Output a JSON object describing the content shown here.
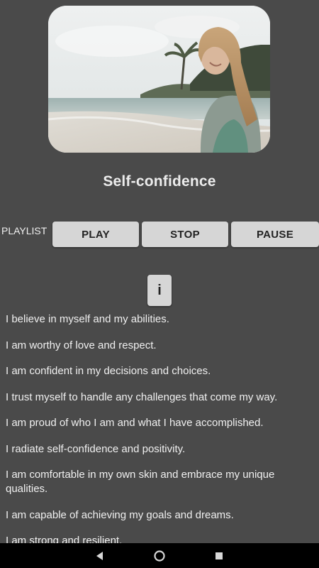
{
  "title": "Self-confidence",
  "controls": {
    "playlist_label": "PLAYLIST",
    "play_label": "PLAY",
    "stop_label": "STOP",
    "pause_label": "PAUSE",
    "info_label": "i"
  },
  "affirmations": [
    "I believe in myself and my abilities.",
    "I am worthy of love and respect.",
    "I am confident in my decisions and choices.",
    "I trust myself to handle any challenges that come my way.",
    "I am proud of who I am and what I have accomplished.",
    "I radiate self-confidence and positivity.",
    "I am comfortable in my own skin and embrace my unique qualities.",
    "I am capable of achieving my goals and dreams.",
    "I am strong and resilient."
  ],
  "navbar": {
    "icons": [
      "back-icon",
      "home-icon",
      "recents-icon"
    ]
  },
  "colors": {
    "background": "#4a4a4a",
    "button": "#d6d6d6",
    "text": "#f0f0f0",
    "navbar": "#000000"
  }
}
